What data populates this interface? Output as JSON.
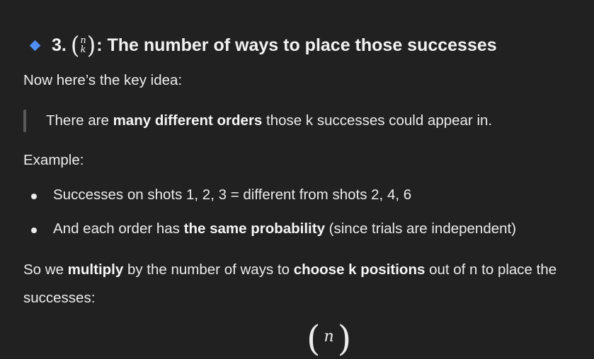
{
  "heading": {
    "number": "3.",
    "binom_top": "n",
    "binom_bottom": "k",
    "title": ": The number of ways to place those successes"
  },
  "intro": "Now here’s the key idea:",
  "quote": {
    "before": "There are ",
    "bold": "many different orders",
    "after": " those k successes could appear in."
  },
  "example_label": "Example:",
  "bullets": [
    {
      "text": "Successes on shots 1, 2, 3 = different from shots 2, 4, 6"
    },
    {
      "before": "And each order has ",
      "bold": "the same probability",
      "after": " (since trials are independent)"
    }
  ],
  "conclusion": {
    "p1": "So we ",
    "b1": "multiply",
    "p2": " by the number of ways to ",
    "b2": "choose k positions",
    "p3": " out of n to place the",
    "line2": "successes:"
  },
  "formula": {
    "top": "n"
  },
  "colors": {
    "background": "#212121",
    "text": "#ececec",
    "diamond": "#4f8ef7",
    "quote_bar": "#5a5a5a"
  }
}
